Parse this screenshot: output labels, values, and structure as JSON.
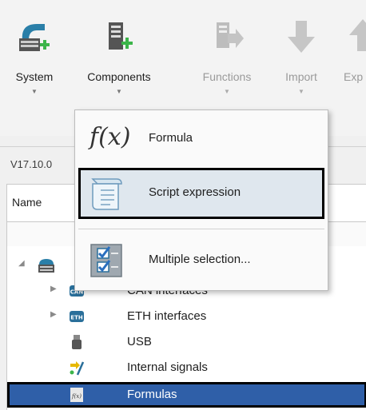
{
  "ribbon": {
    "buttons": [
      {
        "label": "System",
        "icon": "system-add-icon",
        "enabled": true
      },
      {
        "label": "Components",
        "icon": "components-add-icon",
        "enabled": true
      },
      {
        "label": "Functions",
        "icon": "functions-icon",
        "enabled": false
      },
      {
        "label": "Import",
        "icon": "import-arrow-icon",
        "enabled": false
      },
      {
        "label": "Exp",
        "icon": "export-arrow-icon",
        "enabled": false
      }
    ],
    "dropdown_arrow": "▼"
  },
  "version": "V17.10.0",
  "table": {
    "column_name": "Name"
  },
  "menu": {
    "items": [
      {
        "label": "Formula",
        "icon": "formula-fx-icon",
        "icon_text": "f(x)"
      },
      {
        "label": "Script expression",
        "icon": "script-scroll-icon"
      },
      {
        "label": "Multiple selection...",
        "icon": "multiple-selection-checklist-icon"
      }
    ]
  },
  "tree": {
    "items": [
      {
        "label": "",
        "icon": "system-device-icon"
      },
      {
        "label": "CAN interfaces",
        "icon": "can-interface-icon"
      },
      {
        "label": "ETH interfaces",
        "icon": "eth-interface-icon"
      },
      {
        "label": "USB",
        "icon": "usb-icon"
      },
      {
        "label": "Internal signals",
        "icon": "internal-signals-icon"
      },
      {
        "label": "Formulas",
        "icon": "formulas-icon",
        "icon_text": "f(x)",
        "selected": true
      }
    ]
  },
  "colors": {
    "accent_green": "#3cb54a",
    "selection": "#2f5fa8",
    "menu_highlight": "#dfe7ee"
  }
}
